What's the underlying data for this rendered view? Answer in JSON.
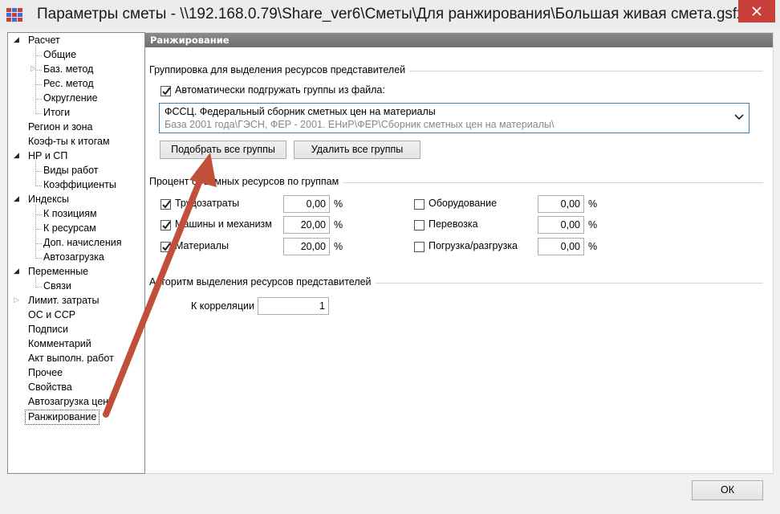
{
  "window": {
    "title": "Параметры сметы - \\\\192.168.0.79\\Share_ver6\\Сметы\\Для ранжирования\\Большая живая смета.gsfx"
  },
  "tree": {
    "items": [
      {
        "label": "Расчет",
        "level": 0,
        "expander": "open"
      },
      {
        "label": "Общие",
        "level": 1
      },
      {
        "label": "Баз. метод",
        "level": 1,
        "expander": "closed"
      },
      {
        "label": "Рес. метод",
        "level": 1
      },
      {
        "label": "Округление",
        "level": 1
      },
      {
        "label": "Итоги",
        "level": 1
      },
      {
        "label": "Регион и зона",
        "level": 0
      },
      {
        "label": "Коэф-ты к итогам",
        "level": 0
      },
      {
        "label": "НР и СП",
        "level": 0,
        "expander": "open"
      },
      {
        "label": "Виды работ",
        "level": 1
      },
      {
        "label": "Коэффициенты",
        "level": 1
      },
      {
        "label": "Индексы",
        "level": 0,
        "expander": "open"
      },
      {
        "label": "К позициям",
        "level": 1
      },
      {
        "label": "К ресурсам",
        "level": 1
      },
      {
        "label": "Доп. начисления",
        "level": 1
      },
      {
        "label": "Автозагрузка",
        "level": 1
      },
      {
        "label": "Переменные",
        "level": 0,
        "expander": "open"
      },
      {
        "label": "Связи",
        "level": 1
      },
      {
        "label": "Лимит. затраты",
        "level": 0,
        "expander": "closed"
      },
      {
        "label": "ОС и ССР",
        "level": 0
      },
      {
        "label": "Подписи",
        "level": 0
      },
      {
        "label": "Комментарий",
        "level": 0
      },
      {
        "label": "Акт выполн. работ",
        "level": 0
      },
      {
        "label": "Прочее",
        "level": 0
      },
      {
        "label": "Свойства",
        "level": 0
      },
      {
        "label": "Автозагрузка цен",
        "level": 0
      },
      {
        "label": "Ранжирование",
        "level": 0,
        "selected": true
      }
    ]
  },
  "panel": {
    "header": "Ранжирование",
    "grouping": {
      "title": "Группировка для выделения ресурсов представителей",
      "auto_load_label": "Автоматически подгружать группы из файла:",
      "auto_load_checked": true,
      "combo_line1": "ФССЦ. Федеральный сборник сметных цен на материалы",
      "combo_line2": "База 2001 года\\ГЭСН, ФЕР - 2001. ЕНиР\\ФЕР\\Сборник сметных цен на материалы\\",
      "select_all_button": "Подобрать все группы",
      "delete_all_button": "Удалить все группы"
    },
    "percent": {
      "title": "Процент объемных ресурсов по группам",
      "unit": "%",
      "left": [
        {
          "label": "Трудозатраты",
          "checked": true,
          "value": "0,00"
        },
        {
          "label": "Машины и механизм",
          "checked": true,
          "value": "20,00"
        },
        {
          "label": "Материалы",
          "checked": true,
          "value": "20,00"
        }
      ],
      "right": [
        {
          "label": "Оборудование",
          "checked": false,
          "value": "0,00"
        },
        {
          "label": "Перевозка",
          "checked": false,
          "value": "0,00"
        },
        {
          "label": "Погрузка/разгрузка",
          "checked": false,
          "value": "0,00"
        }
      ]
    },
    "algorithm": {
      "title": "Алгоритм выделения ресурсов представителей",
      "correlation_label": "К корреляции",
      "correlation_value": "1"
    }
  },
  "footer": {
    "ok_label": "ОК"
  },
  "colors": {
    "close_button": "#c7413a",
    "arrow": "#c0503a",
    "header_bar": "#7a7a7a",
    "combo_border": "#3c7fb1"
  },
  "icons": {
    "app": "grid-app-icon",
    "close": "close-icon",
    "check": "check-icon",
    "chevron": "chevron-down-icon",
    "annotation": "red-arrow-annotation"
  }
}
